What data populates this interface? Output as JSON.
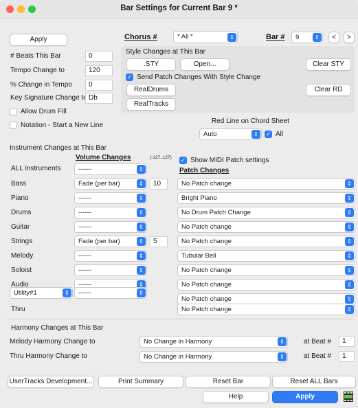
{
  "window": {
    "title": "Bar Settings for Current Bar 9 *"
  },
  "colors": {
    "accent": "#2f7cf6",
    "close": "#ff5f57",
    "minimize": "#febc2e",
    "zoom": "#28c840"
  },
  "top": {
    "apply_label": "Apply",
    "chorus_label": "Chorus #",
    "chorus_value": "* All *",
    "bar_label": "Bar #",
    "bar_value": "9",
    "prev_label": "<",
    "next_label": ">"
  },
  "left": {
    "beats_label": "# Beats This Bar",
    "beats_value": "0",
    "tempo_label": "Tempo Change to",
    "tempo_value": "120",
    "pct_tempo_label": "% Change in Tempo",
    "pct_tempo_value": "0",
    "key_label": "Key Signature Change to",
    "key_value": "Db",
    "drum_fill_label": "Allow Drum Fill",
    "notation_label": "Notation - Start a New Line"
  },
  "style": {
    "heading": "Style Changes at This Bar",
    "sty_label": ".STY",
    "open_label": "Open...",
    "clear_sty_label": "Clear STY",
    "send_patch_label": "Send Patch Changes With Style Change",
    "realdrums_label": "RealDrums",
    "clear_rd_label": "Clear RD",
    "realtracks_label": "RealTracks"
  },
  "redline": {
    "label": "Red Line on Chord Sheet",
    "value": "Auto",
    "all_label": "All"
  },
  "instruments": {
    "heading": "Instrument Changes at This Bar",
    "volume_header": "Volume Changes",
    "volume_range": "(-127..127)",
    "show_midi_label": "Show MIDI Patch settings",
    "patch_header": "Patch Changes",
    "rows": [
      {
        "name": "ALL Instruments",
        "volume": "------",
        "amount": "",
        "patch": ""
      },
      {
        "name": "Bass",
        "volume": "Fade (per bar)",
        "amount": "10",
        "patch": "No Patch change"
      },
      {
        "name": "Piano",
        "volume": "------",
        "amount": "",
        "patch": "Bright Piano"
      },
      {
        "name": "Drums",
        "volume": "------",
        "amount": "",
        "patch": "No Drum Patch Change"
      },
      {
        "name": "Guitar",
        "volume": "------",
        "amount": "",
        "patch": "No Patch change"
      },
      {
        "name": "Strings",
        "volume": "Fade (per bar)",
        "amount": "5",
        "patch": "No Patch change"
      },
      {
        "name": "Melody",
        "volume": "------",
        "amount": "",
        "patch": "Tubular Bell"
      },
      {
        "name": "Soloist",
        "volume": "------",
        "amount": "",
        "patch": "No Patch change"
      },
      {
        "name": "Audio",
        "volume": "------",
        "amount": "",
        "patch": "No Patch change"
      },
      {
        "name": "Utility#1",
        "volume": "------",
        "amount": "",
        "patch": "No Patch change"
      },
      {
        "name": "Thru",
        "volume": "",
        "amount": "",
        "patch": "No Patch change"
      }
    ]
  },
  "harmony": {
    "heading": "Harmony Changes at This Bar",
    "melody_label": "Melody Harmony Change to",
    "melody_value": "No Change in Harmony",
    "melody_beat_label": "at Beat #",
    "melody_beat_value": "1",
    "thru_label": "Thru Harmony Change to",
    "thru_value": "No Change in Harmony",
    "thru_beat_label": "at Beat #",
    "thru_beat_value": "1"
  },
  "bottom": {
    "usertracks_label": "UserTracks Development...",
    "print_label": "Print Summary",
    "reset_bar_label": "Reset Bar",
    "reset_all_label": "Reset ALL Bars",
    "help_label": "Help",
    "apply_label": "Apply"
  }
}
